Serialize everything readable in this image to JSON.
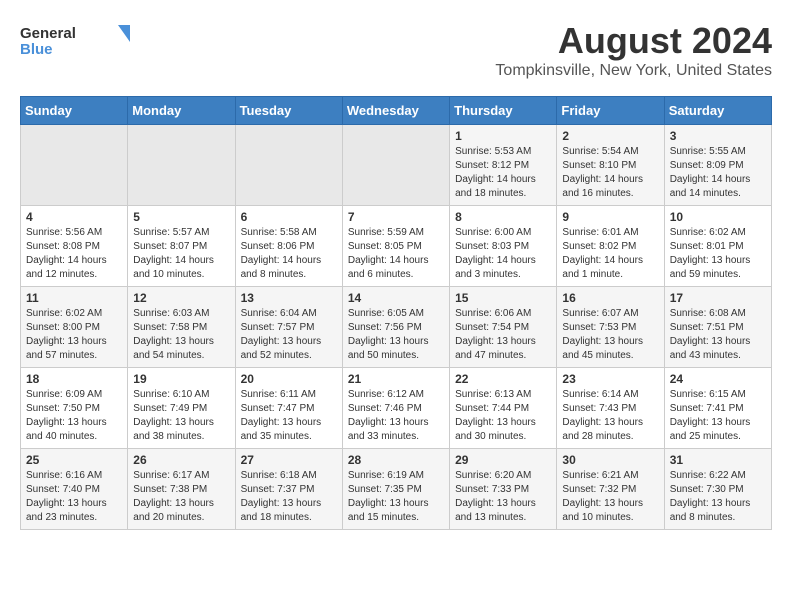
{
  "header": {
    "logo_general": "General",
    "logo_blue": "Blue",
    "title": "August 2024",
    "subtitle": "Tompkinsville, New York, United States"
  },
  "days_of_week": [
    "Sunday",
    "Monday",
    "Tuesday",
    "Wednesday",
    "Thursday",
    "Friday",
    "Saturday"
  ],
  "weeks": [
    [
      {
        "day": "",
        "info": ""
      },
      {
        "day": "",
        "info": ""
      },
      {
        "day": "",
        "info": ""
      },
      {
        "day": "",
        "info": ""
      },
      {
        "day": "1",
        "info": "Sunrise: 5:53 AM\nSunset: 8:12 PM\nDaylight: 14 hours\nand 18 minutes."
      },
      {
        "day": "2",
        "info": "Sunrise: 5:54 AM\nSunset: 8:10 PM\nDaylight: 14 hours\nand 16 minutes."
      },
      {
        "day": "3",
        "info": "Sunrise: 5:55 AM\nSunset: 8:09 PM\nDaylight: 14 hours\nand 14 minutes."
      }
    ],
    [
      {
        "day": "4",
        "info": "Sunrise: 5:56 AM\nSunset: 8:08 PM\nDaylight: 14 hours\nand 12 minutes."
      },
      {
        "day": "5",
        "info": "Sunrise: 5:57 AM\nSunset: 8:07 PM\nDaylight: 14 hours\nand 10 minutes."
      },
      {
        "day": "6",
        "info": "Sunrise: 5:58 AM\nSunset: 8:06 PM\nDaylight: 14 hours\nand 8 minutes."
      },
      {
        "day": "7",
        "info": "Sunrise: 5:59 AM\nSunset: 8:05 PM\nDaylight: 14 hours\nand 6 minutes."
      },
      {
        "day": "8",
        "info": "Sunrise: 6:00 AM\nSunset: 8:03 PM\nDaylight: 14 hours\nand 3 minutes."
      },
      {
        "day": "9",
        "info": "Sunrise: 6:01 AM\nSunset: 8:02 PM\nDaylight: 14 hours\nand 1 minute."
      },
      {
        "day": "10",
        "info": "Sunrise: 6:02 AM\nSunset: 8:01 PM\nDaylight: 13 hours\nand 59 minutes."
      }
    ],
    [
      {
        "day": "11",
        "info": "Sunrise: 6:02 AM\nSunset: 8:00 PM\nDaylight: 13 hours\nand 57 minutes."
      },
      {
        "day": "12",
        "info": "Sunrise: 6:03 AM\nSunset: 7:58 PM\nDaylight: 13 hours\nand 54 minutes."
      },
      {
        "day": "13",
        "info": "Sunrise: 6:04 AM\nSunset: 7:57 PM\nDaylight: 13 hours\nand 52 minutes."
      },
      {
        "day": "14",
        "info": "Sunrise: 6:05 AM\nSunset: 7:56 PM\nDaylight: 13 hours\nand 50 minutes."
      },
      {
        "day": "15",
        "info": "Sunrise: 6:06 AM\nSunset: 7:54 PM\nDaylight: 13 hours\nand 47 minutes."
      },
      {
        "day": "16",
        "info": "Sunrise: 6:07 AM\nSunset: 7:53 PM\nDaylight: 13 hours\nand 45 minutes."
      },
      {
        "day": "17",
        "info": "Sunrise: 6:08 AM\nSunset: 7:51 PM\nDaylight: 13 hours\nand 43 minutes."
      }
    ],
    [
      {
        "day": "18",
        "info": "Sunrise: 6:09 AM\nSunset: 7:50 PM\nDaylight: 13 hours\nand 40 minutes."
      },
      {
        "day": "19",
        "info": "Sunrise: 6:10 AM\nSunset: 7:49 PM\nDaylight: 13 hours\nand 38 minutes."
      },
      {
        "day": "20",
        "info": "Sunrise: 6:11 AM\nSunset: 7:47 PM\nDaylight: 13 hours\nand 35 minutes."
      },
      {
        "day": "21",
        "info": "Sunrise: 6:12 AM\nSunset: 7:46 PM\nDaylight: 13 hours\nand 33 minutes."
      },
      {
        "day": "22",
        "info": "Sunrise: 6:13 AM\nSunset: 7:44 PM\nDaylight: 13 hours\nand 30 minutes."
      },
      {
        "day": "23",
        "info": "Sunrise: 6:14 AM\nSunset: 7:43 PM\nDaylight: 13 hours\nand 28 minutes."
      },
      {
        "day": "24",
        "info": "Sunrise: 6:15 AM\nSunset: 7:41 PM\nDaylight: 13 hours\nand 25 minutes."
      }
    ],
    [
      {
        "day": "25",
        "info": "Sunrise: 6:16 AM\nSunset: 7:40 PM\nDaylight: 13 hours\nand 23 minutes."
      },
      {
        "day": "26",
        "info": "Sunrise: 6:17 AM\nSunset: 7:38 PM\nDaylight: 13 hours\nand 20 minutes."
      },
      {
        "day": "27",
        "info": "Sunrise: 6:18 AM\nSunset: 7:37 PM\nDaylight: 13 hours\nand 18 minutes."
      },
      {
        "day": "28",
        "info": "Sunrise: 6:19 AM\nSunset: 7:35 PM\nDaylight: 13 hours\nand 15 minutes."
      },
      {
        "day": "29",
        "info": "Sunrise: 6:20 AM\nSunset: 7:33 PM\nDaylight: 13 hours\nand 13 minutes."
      },
      {
        "day": "30",
        "info": "Sunrise: 6:21 AM\nSunset: 7:32 PM\nDaylight: 13 hours\nand 10 minutes."
      },
      {
        "day": "31",
        "info": "Sunrise: 6:22 AM\nSunset: 7:30 PM\nDaylight: 13 hours\nand 8 minutes."
      }
    ]
  ]
}
